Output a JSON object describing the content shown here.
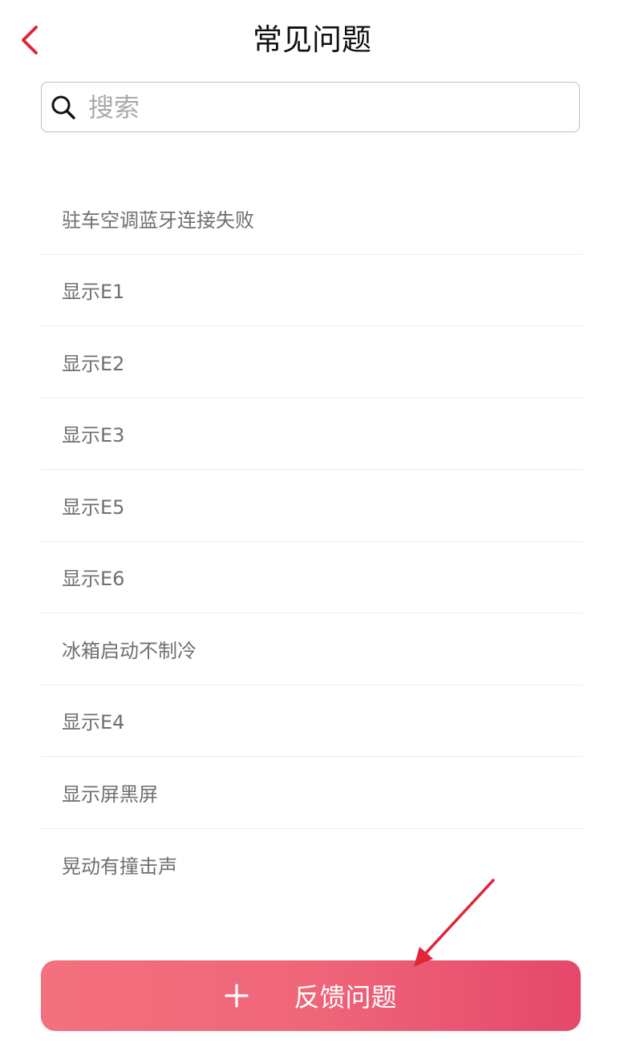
{
  "header": {
    "title": "常见问题",
    "back_icon": "chevron-left-icon"
  },
  "search": {
    "placeholder": "搜索",
    "value": "",
    "icon": "search-icon"
  },
  "faq": {
    "items": [
      {
        "label": "驻车空调蓝牙连接失败"
      },
      {
        "label": "显示E1"
      },
      {
        "label": "显示E2"
      },
      {
        "label": "显示E3"
      },
      {
        "label": "显示E5"
      },
      {
        "label": "显示E6"
      },
      {
        "label": "冰箱启动不制冷"
      },
      {
        "label": "显示E4"
      },
      {
        "label": "显示屏黑屏"
      },
      {
        "label": "晃动有撞击声"
      }
    ]
  },
  "feedback": {
    "label": "反馈问题",
    "icon": "plus-icon"
  },
  "colors": {
    "accent": "#e0273a",
    "button_gradient_start": "#f3707d",
    "button_gradient_end": "#e5486b",
    "annotation_arrow": "#e0273a"
  }
}
